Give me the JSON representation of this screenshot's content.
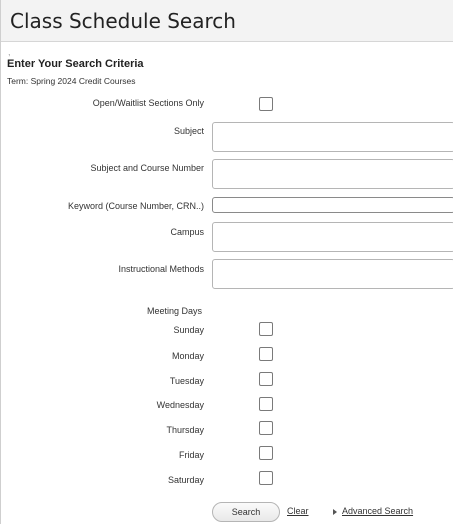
{
  "page": {
    "title": "Class Schedule Search"
  },
  "criteria": {
    "heading": "Enter Your Search Criteria",
    "term": "Term: Spring 2024 Credit Courses"
  },
  "fields": {
    "open_waitlist_label": "Open/Waitlist Sections Only",
    "subject_label": "Subject",
    "subject_value": "",
    "subject_course_label": "Subject and Course Number",
    "subject_course_value": "",
    "keyword_label": "Keyword (Course Number, CRN..)",
    "keyword_value": "",
    "campus_label": "Campus",
    "campus_value": "",
    "instructional_label": "Instructional Methods",
    "instructional_value": ""
  },
  "meeting_days": {
    "label": "Meeting Days",
    "days": [
      "Sunday",
      "Monday",
      "Tuesday",
      "Wednesday",
      "Thursday",
      "Friday",
      "Saturday"
    ]
  },
  "actions": {
    "search": "Search",
    "clear": "Clear",
    "advanced": "Advanced Search"
  }
}
